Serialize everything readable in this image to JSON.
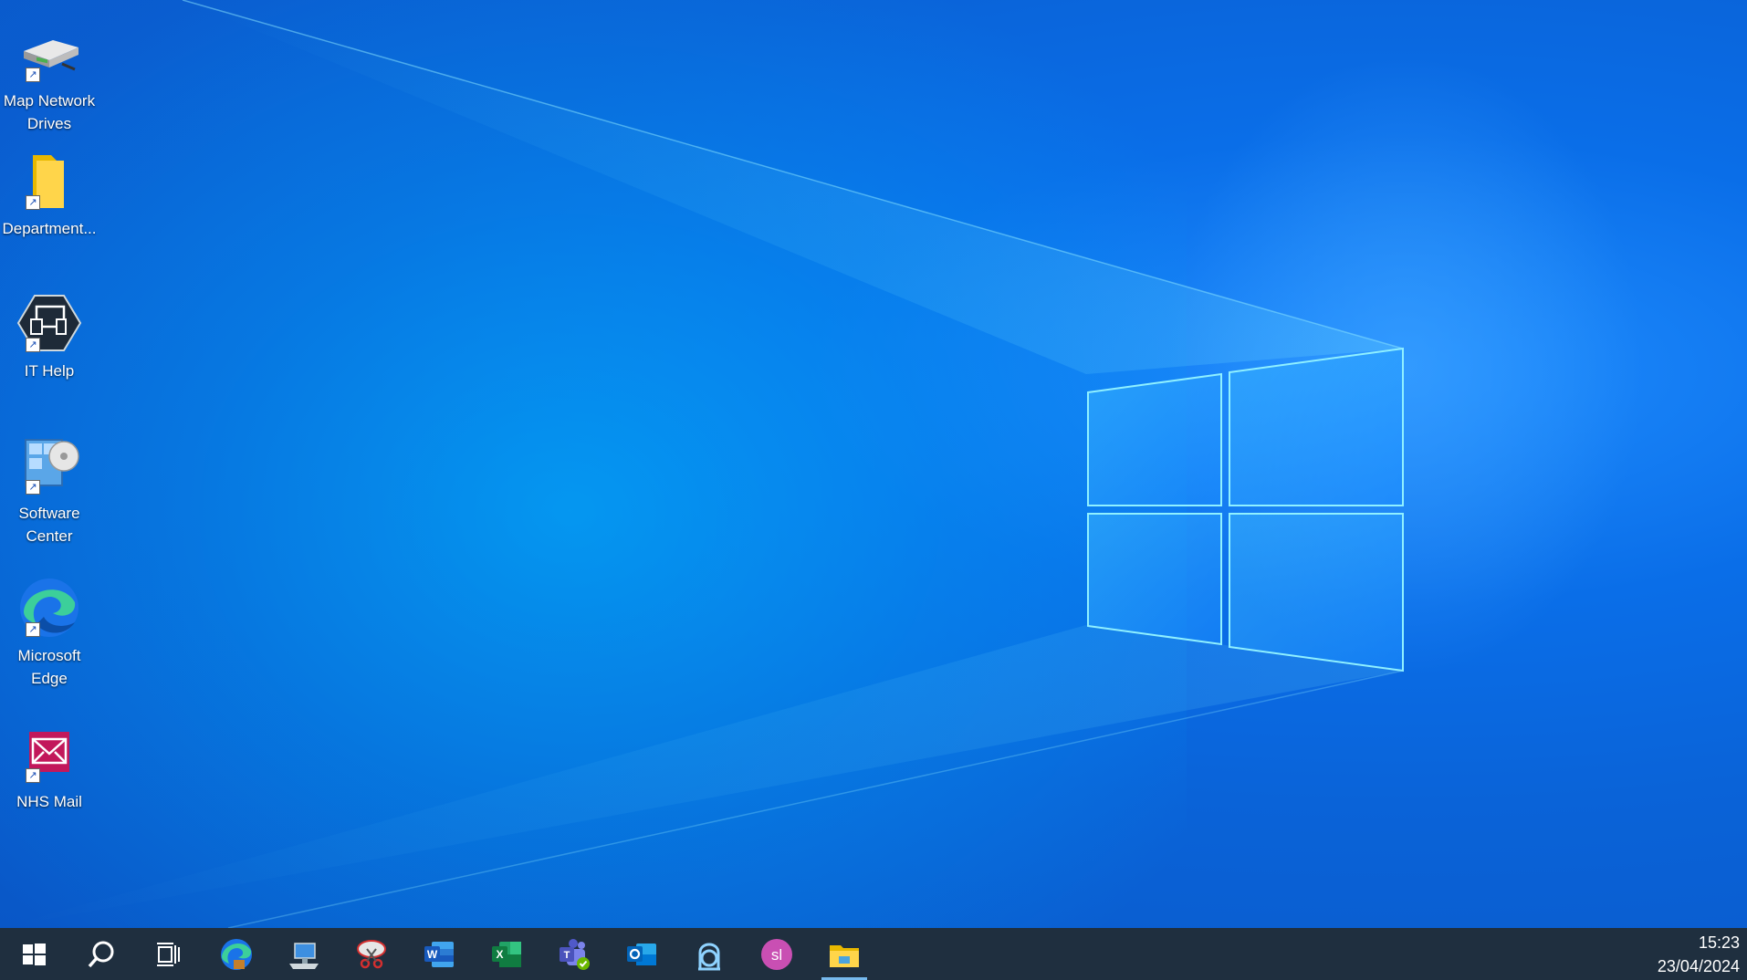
{
  "desktop": {
    "icons": [
      {
        "label": "Map Network Drives",
        "icon": "network-drive-icon"
      },
      {
        "label": "Department...",
        "icon": "folder-icon"
      },
      {
        "label": "IT Help",
        "icon": "it-help-icon"
      },
      {
        "label": "Software Center",
        "icon": "software-center-icon"
      },
      {
        "label": "Microsoft Edge",
        "icon": "edge-icon"
      },
      {
        "label": "NHS Mail",
        "icon": "mail-icon"
      }
    ]
  },
  "taskbar": {
    "items": [
      {
        "icon": "windows-start-icon"
      },
      {
        "icon": "search-icon"
      },
      {
        "icon": "task-view-icon"
      },
      {
        "icon": "edge-icon"
      },
      {
        "icon": "remote-desktop-icon"
      },
      {
        "icon": "snipping-tool-icon"
      },
      {
        "icon": "word-icon"
      },
      {
        "icon": "excel-icon"
      },
      {
        "icon": "teams-icon"
      },
      {
        "icon": "outlook-icon"
      },
      {
        "icon": "lock-app-icon"
      },
      {
        "icon": "avatar-icon",
        "text": "sl",
        "color": "#c94fb3"
      },
      {
        "icon": "file-explorer-icon"
      }
    ],
    "clock": {
      "time": "15:23",
      "date": "23/04/2024"
    }
  }
}
